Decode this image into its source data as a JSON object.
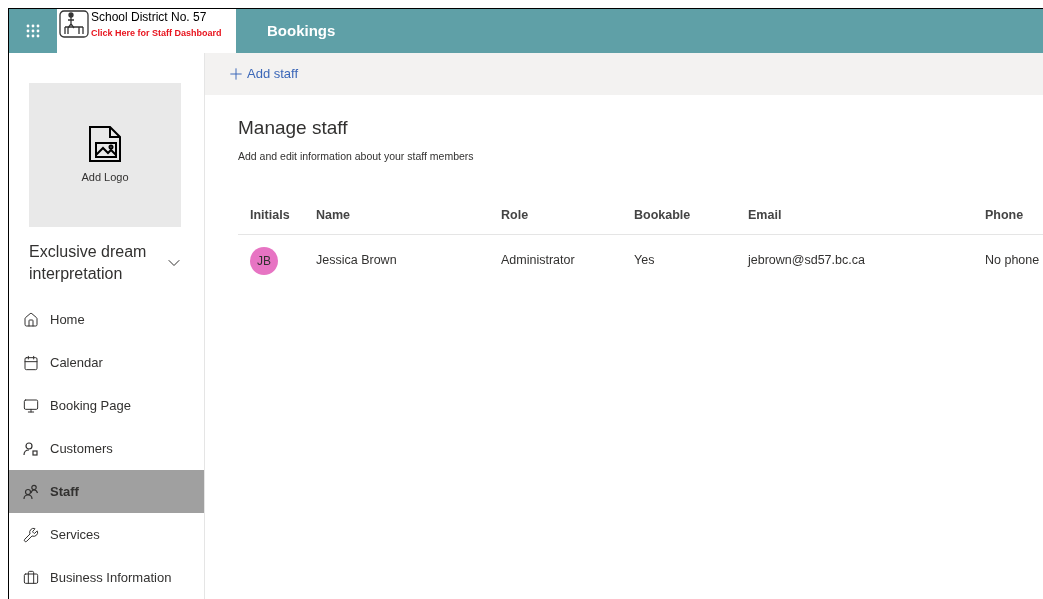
{
  "header": {
    "org_name": "School District No. 57",
    "dashboard_link": "Click Here for Staff Dashboard",
    "app_title": "Bookings"
  },
  "sidebar": {
    "logo_label": "Add Logo",
    "business_name": "Exclusive dream interpretation",
    "items": [
      {
        "label": "Home",
        "selected": false
      },
      {
        "label": "Calendar",
        "selected": false
      },
      {
        "label": "Booking Page",
        "selected": false
      },
      {
        "label": "Customers",
        "selected": false
      },
      {
        "label": "Staff",
        "selected": true
      },
      {
        "label": "Services",
        "selected": false
      },
      {
        "label": "Business Information",
        "selected": false
      }
    ]
  },
  "toolbar": {
    "add_button": "Add staff"
  },
  "page": {
    "title": "Manage staff",
    "subtitle": "Add and edit information about your staff members"
  },
  "table": {
    "columns": [
      "Initials",
      "Name",
      "Role",
      "Bookable",
      "Email",
      "Phone"
    ],
    "rows": [
      {
        "initials": "JB",
        "color": "#e774c3",
        "name": "Jessica Brown",
        "role": "Administrator",
        "bookable": "Yes",
        "email": "jebrown@sd57.bc.ca",
        "phone": "No phone"
      }
    ]
  }
}
